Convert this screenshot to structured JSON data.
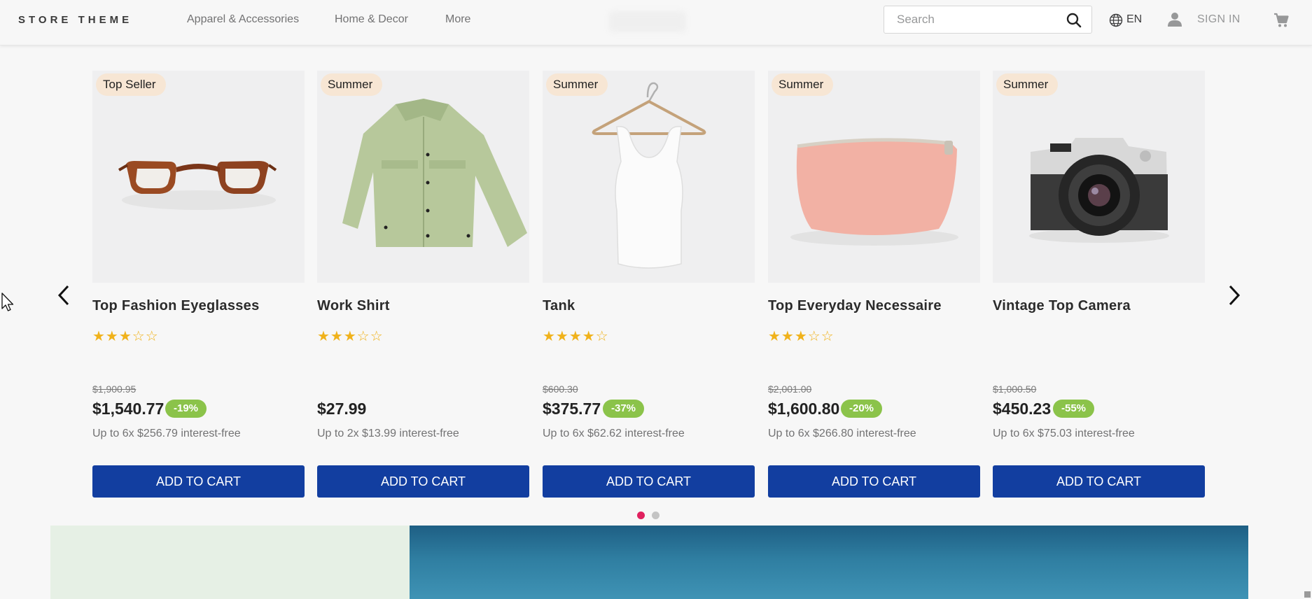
{
  "header": {
    "logo": "STORE THEME",
    "nav": [
      "Apparel & Accessories",
      "Home & Decor",
      "More"
    ],
    "search_placeholder": "Search",
    "language": "EN",
    "sign_in": "SIGN IN"
  },
  "products": [
    {
      "badge": "Top Seller",
      "name": "Top Fashion Eyeglasses",
      "stars": "★★★☆☆",
      "rating": 3,
      "list_price": "$1,900.95",
      "price": "$1,540.77",
      "discount": "-19%",
      "installments": "Up to 6x $256.79 interest-free",
      "button": "ADD TO CART"
    },
    {
      "badge": "Summer",
      "name": "Work Shirt",
      "stars": "★★★☆☆",
      "rating": 3,
      "list_price": "",
      "price": "$27.99",
      "discount": "",
      "installments": "Up to 2x $13.99 interest-free",
      "button": "ADD TO CART"
    },
    {
      "badge": "Summer",
      "name": "Tank",
      "stars": "★★★★☆",
      "rating": 4,
      "list_price": "$600.30",
      "price": "$375.77",
      "discount": "-37%",
      "installments": "Up to 6x $62.62 interest-free",
      "button": "ADD TO CART"
    },
    {
      "badge": "Summer",
      "name": "Top Everyday Necessaire",
      "stars": "★★★☆☆",
      "rating": 3,
      "list_price": "$2,001.00",
      "price": "$1,600.80",
      "discount": "-20%",
      "installments": "Up to 6x $266.80 interest-free",
      "button": "ADD TO CART"
    },
    {
      "badge": "Summer",
      "name": "Vintage Top Camera",
      "stars": "",
      "rating": 0,
      "list_price": "$1,000.50",
      "price": "$450.23",
      "discount": "-55%",
      "installments": "Up to 6x $75.03 interest-free",
      "button": "ADD TO CART"
    }
  ],
  "carousel": {
    "pages": 2,
    "active_page": 1
  },
  "colors": {
    "button": "#123ea0",
    "discount": "#8bc34a",
    "badge": "#f7e6d4",
    "star": "#f0b21b",
    "active_dot": "#e0215f",
    "inactive_dot": "#c4c4c4"
  }
}
